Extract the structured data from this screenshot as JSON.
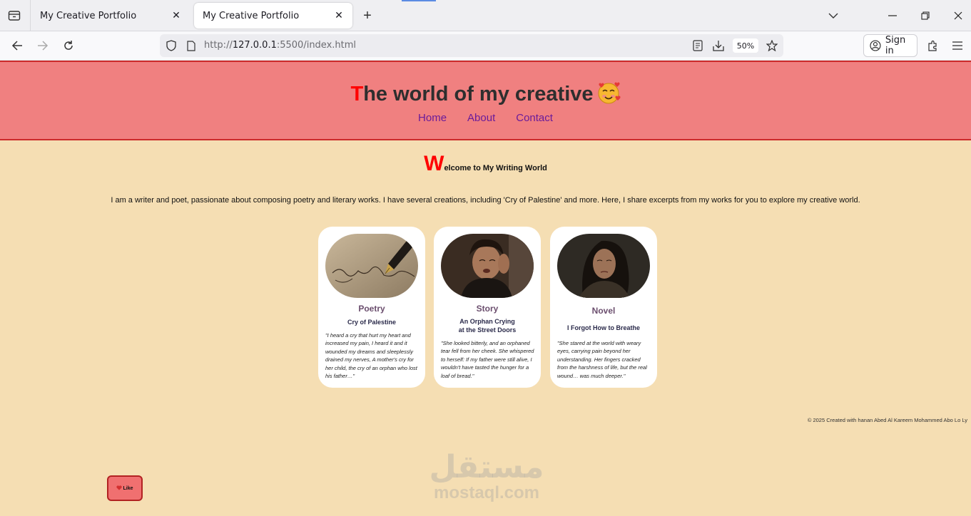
{
  "browser": {
    "tabs": [
      {
        "title": "My Creative Portfolio",
        "active": false
      },
      {
        "title": "My Creative Portfolio",
        "active": true
      }
    ],
    "url_prefix": "http://",
    "url_host": "127.0.0.1",
    "url_rest": ":5500/index.html",
    "zoom": "50%",
    "sign_in": "Sign in"
  },
  "site": {
    "title_first": "T",
    "title_rest": "he world of my creative",
    "nav": [
      "Home",
      "About",
      "Contact"
    ],
    "welcome_first": "W",
    "welcome_rest": "elcome to My Writing World",
    "intro": "I am a writer and poet, passionate about composing poetry and literary works. I have several creations, including 'Cry of Palestine' and more. Here, I share excerpts from my works for you to explore my creative world.",
    "cards": [
      {
        "category": "Poetry",
        "title": "Cry of Palestine",
        "excerpt": "\"I heard a cry that hurt my heart and increased my pain, I heard it and it wounded my dreams and sleeplessly drained my nerves, A mother's cry for her child, the cry of an orphan who lost his father…\""
      },
      {
        "category": "Story",
        "title_line1": "An Orphan Crying",
        "title_line2": "at the Street Doors",
        "excerpt": "\"She looked bitterly, and an orphaned tear fell from her cheek. She whispered to herself: If my father were still alive, I wouldn't have tasted the hunger for a loaf of bread.\""
      },
      {
        "category": "Novel",
        "title": "I Forgot How to Breathe",
        "excerpt": "\"She stared at the world with weary eyes, carrying pain beyond her understanding. Her fingers cracked from the harshness of life, but the real wound… was much deeper.\""
      }
    ],
    "footer": "© 2025 Created with hanan Abed Al Kareem Mohammed Abo Lo Ly",
    "like": "Like",
    "watermark_ar": "مستقل",
    "watermark_lat": "mostaql.com"
  },
  "colors": {
    "header_bg": "#f08080",
    "page_bg": "#f5deb3",
    "accent_red": "#ff0000",
    "nav_link": "#6a1b9a"
  }
}
